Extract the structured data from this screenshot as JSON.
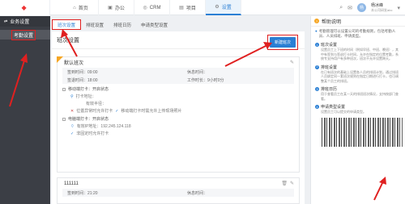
{
  "topnav": {
    "items": [
      {
        "icon": "home-icon",
        "glyph": "⌂",
        "label": "首页"
      },
      {
        "icon": "office-icon",
        "glyph": "▣",
        "label": "办公"
      },
      {
        "icon": "crm-icon",
        "glyph": "◎",
        "label": "CRM"
      },
      {
        "icon": "project-icon",
        "glyph": "▤",
        "label": "项目"
      },
      {
        "icon": "settings-icon",
        "glyph": "⚙",
        "label": "设置"
      }
    ],
    "user_name": "杨冰峰",
    "user_org": "本公司研发abc",
    "avatar_text": "杨"
  },
  "sidebar": {
    "header": "业务设置",
    "item": "考勤设置"
  },
  "tabs": [
    "班次设置",
    "排班设置",
    "排班日历",
    "申请类型设置"
  ],
  "main": {
    "title": "班次设置",
    "add_button": "新建班次",
    "card1": {
      "title": "默认班次",
      "start_label": "签到时间：09:00",
      "rest_label": "休息时间：",
      "end_label": "签退时间：18:00",
      "work_label": "工作时长：9小时0分",
      "sect1": "移动端打卡：开启状态",
      "sub1": "打卡地址：",
      "sub2": "有效半径：",
      "sub3a": "位置异常时允许打卡",
      "sub3b": "移动端打卡时需允许上传现场照片",
      "sect2": "电脑端打卡：开启状态",
      "sub4": "有效IP地址：192.245.124.118",
      "sub5": "非固定时允许打卡"
    },
    "card2": {
      "title": "111111",
      "start_label": "签到时间：21:20",
      "rest_label": "休息时间："
    }
  },
  "help": {
    "title": "帮助说明",
    "intro": "考勤管理可以设置公司的考勤规则，包括考勤人员、人员排班、申请类型。",
    "sections": [
      {
        "n": "1",
        "title": "班次设置",
        "text": "设置员工上下班的时间（例如早班、中班、晚班），其中有签到与签退打卡时间，允许在指定的位置考勤，系统专支持用户有多种班次，班次不允许设置跨天。"
      },
      {
        "n": "2",
        "title": "排班设置",
        "text": "在已有班次的基础上设置各人员的排班计划，通过排班人员绑定同一套班次规则在指定日期进行打卡，也可调整某个员工的排班。"
      },
      {
        "n": "3",
        "title": "排班日历",
        "text": "用于查看员工在某一天的排班班次情况，支持按部门查看。"
      },
      {
        "n": "4",
        "title": "申请类型设置",
        "text": "设置员工可以提交的申请类型。"
      }
    ]
  }
}
